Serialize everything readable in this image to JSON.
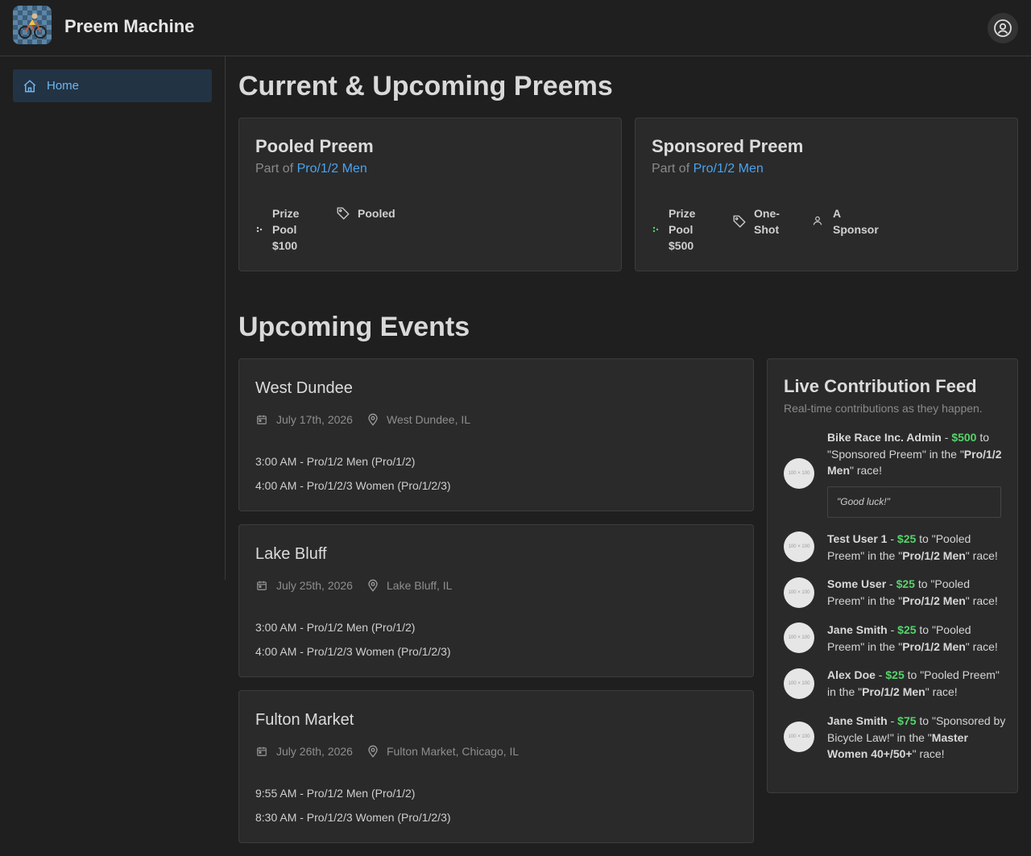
{
  "app": {
    "title": "Preem Machine"
  },
  "sidebar": {
    "items": [
      {
        "label": "Home"
      }
    ]
  },
  "preems": {
    "heading": "Current & Upcoming Preems",
    "cards": [
      {
        "title": "Pooled Preem",
        "part_of": "Part of",
        "race": "Pro/1/2 Men",
        "prize_label": "Prize Pool",
        "prize_value": "$100",
        "type": "Pooled",
        "sponsor": ""
      },
      {
        "title": "Sponsored Preem",
        "part_of": "Part of",
        "race": "Pro/1/2 Men",
        "prize_label": "Prize Pool",
        "prize_value": "$500",
        "type": "One-Shot",
        "sponsor": "A Sponsor"
      }
    ]
  },
  "events": {
    "heading": "Upcoming Events",
    "items": [
      {
        "name": "West Dundee",
        "date": "July 17th, 2026",
        "location": "West Dundee, IL",
        "races": [
          "3:00 AM - Pro/1/2 Men (Pro/1/2)",
          "4:00 AM - Pro/1/2/3 Women (Pro/1/2/3)"
        ]
      },
      {
        "name": "Lake Bluff",
        "date": "July 25th, 2026",
        "location": "Lake Bluff, IL",
        "races": [
          "3:00 AM - Pro/1/2 Men (Pro/1/2)",
          "4:00 AM - Pro/1/2/3 Women (Pro/1/2/3)"
        ]
      },
      {
        "name": "Fulton Market",
        "date": "July 26th, 2026",
        "location": "Fulton Market, Chicago, IL",
        "races": [
          "9:55 AM - Pro/1/2 Men (Pro/1/2)",
          "8:30 AM - Pro/1/2/3 Women (Pro/1/2/3)"
        ]
      }
    ]
  },
  "feed": {
    "title": "Live Contribution Feed",
    "subtitle": "Real-time contributions as they happen.",
    "avatar_text": "100 × 100",
    "items": [
      {
        "user": "Bike Race Inc. Admin",
        "amount": "$500",
        "preem": "Sponsored Preem",
        "race": "Pro/1/2 Men",
        "message": "\"Good luck!\""
      },
      {
        "user": "Test User 1",
        "amount": "$25",
        "preem": "Pooled Preem",
        "race": "Pro/1/2 Men"
      },
      {
        "user": "Some User",
        "amount": "$25",
        "preem": "Pooled Preem",
        "race": "Pro/1/2 Men"
      },
      {
        "user": "Jane Smith",
        "amount": "$25",
        "preem": "Pooled Preem",
        "race": "Pro/1/2 Men"
      },
      {
        "user": "Alex Doe",
        "amount": "$25",
        "preem": "Pooled Preem",
        "race": "Pro/1/2 Men"
      },
      {
        "user": "Jane Smith",
        "amount": "$75",
        "preem": "Sponsored by Bicycle Law!",
        "race": "Master Women 40+/50+"
      }
    ]
  },
  "colors": {
    "accent": "#4aa3ef",
    "amount": "#56d36b",
    "background": "#1f1f1f",
    "card": "#2a2a2a"
  },
  "icons": [
    "logo-icon",
    "account-icon",
    "home-icon",
    "sparkle-icon",
    "tag-icon",
    "user-icon",
    "calendar-icon",
    "map-pin-icon"
  ]
}
